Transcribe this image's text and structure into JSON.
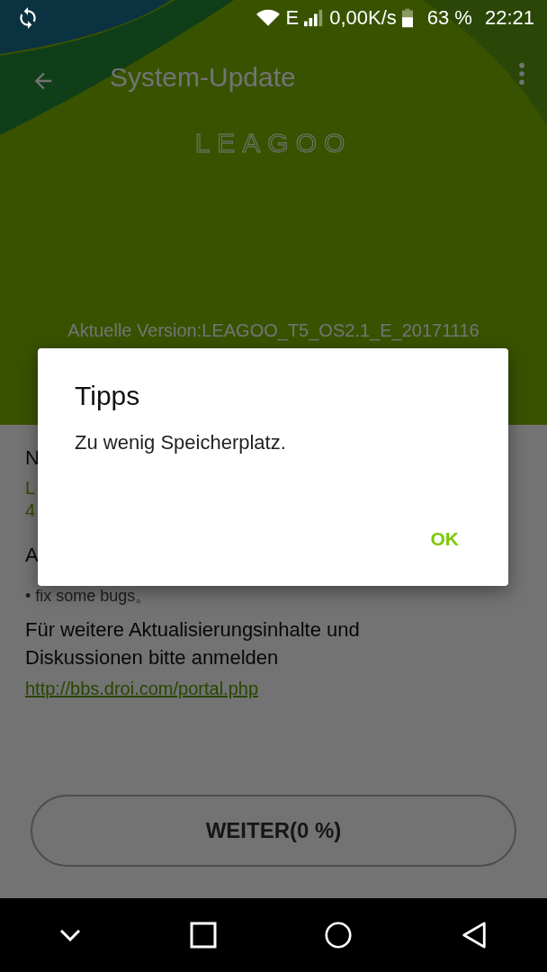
{
  "status_bar": {
    "network": "E",
    "speed": "0,00K/s",
    "battery": "63 %",
    "time": "22:21"
  },
  "app_bar": {
    "title": "System-Update"
  },
  "logo": "LEAGOO",
  "current_version": "Aktuelle Version:LEAGOO_T5_OS2.1_E_20171116",
  "new_version_label": "N",
  "new_version_lines": [
    "L",
    "4"
  ],
  "changes_label": "A",
  "changes": [
    "• fix some bugs。"
  ],
  "info": "Für weitere Aktualisierungsinhalte und Diskussionen bitte anmelden",
  "link": "http://bbs.droi.com/portal.php",
  "continue_button": "WEITER(0 %)",
  "dialog": {
    "title": "Tipps",
    "message": "Zu wenig Speicherplatz.",
    "buttons": [
      "OK"
    ]
  }
}
